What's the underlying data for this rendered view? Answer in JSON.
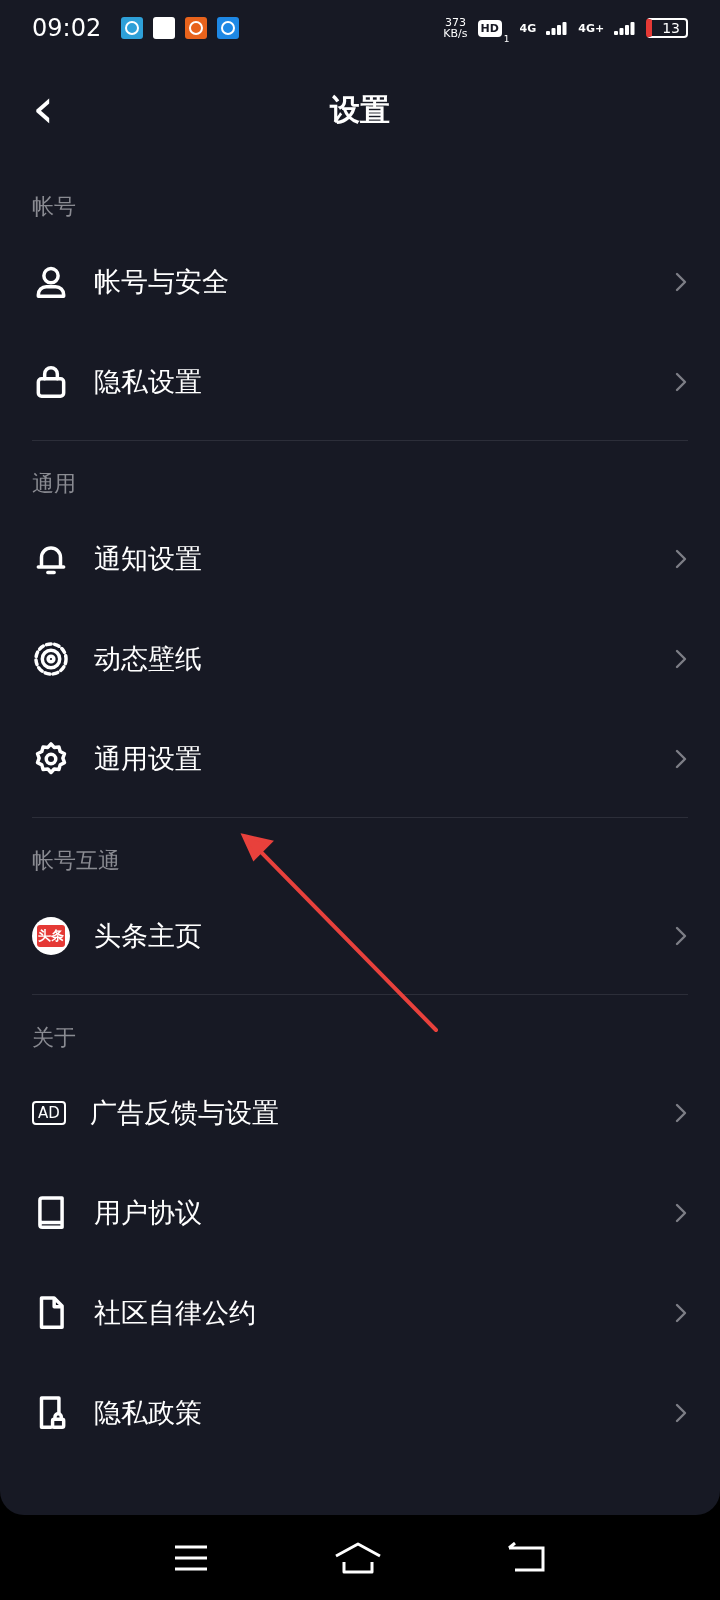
{
  "status_bar": {
    "time": "09:02",
    "speed_value": "373",
    "speed_unit": "KB/s",
    "hd": "HD",
    "hd_sub": "1",
    "network_1": "4G",
    "network_2": "4G+",
    "battery": "13"
  },
  "header": {
    "back": "‹",
    "title": "设置"
  },
  "sections": [
    {
      "title": "帐号",
      "rows": [
        {
          "label": "帐号与安全"
        },
        {
          "label": "隐私设置"
        }
      ]
    },
    {
      "title": "通用",
      "rows": [
        {
          "label": "通知设置"
        },
        {
          "label": "动态壁纸"
        },
        {
          "label": "通用设置"
        }
      ]
    },
    {
      "title": "帐号互通",
      "rows": [
        {
          "label": "头条主页",
          "badge": "头条"
        }
      ]
    },
    {
      "title": "关于",
      "rows": [
        {
          "label": "广告反馈与设置",
          "ad_mark": "AD"
        },
        {
          "label": "用户协议"
        },
        {
          "label": "社区自律公约"
        },
        {
          "label": "隐私政策"
        }
      ]
    }
  ]
}
